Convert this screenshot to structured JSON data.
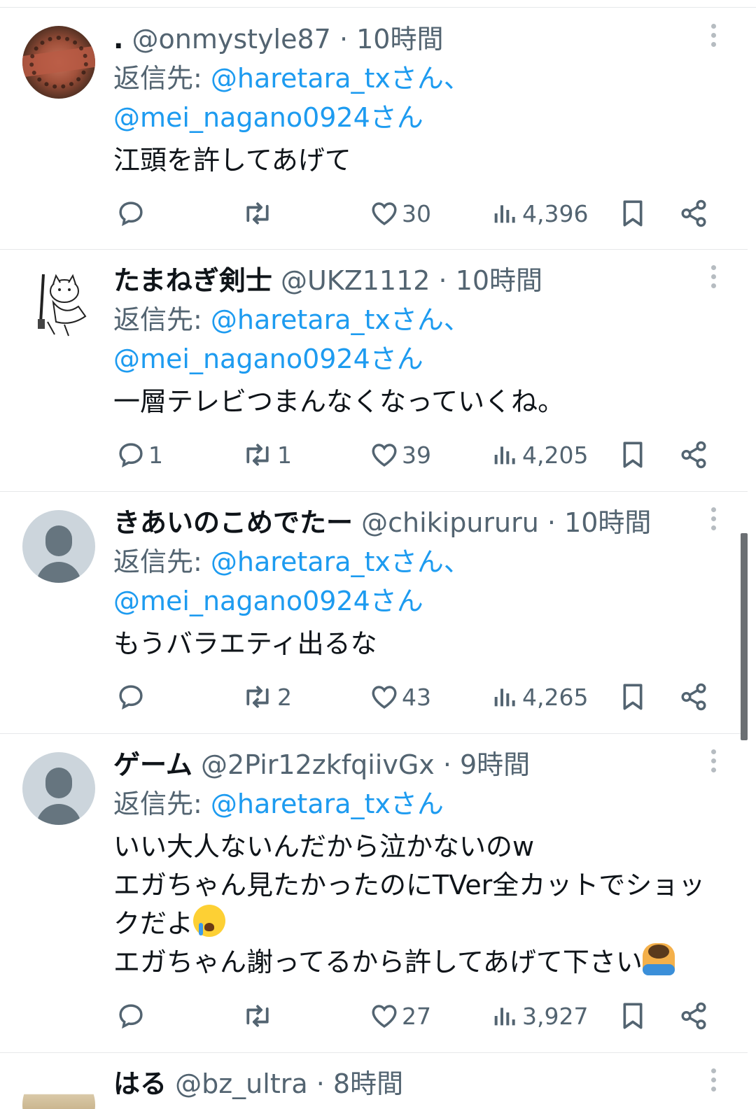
{
  "tweets": [
    {
      "name": ".",
      "handle": "@onmystyle87",
      "time": "10時間",
      "reply_prefix": "返信先: ",
      "mentions": "@haretara_txさん、@mei_nagano0924さん",
      "text": "江頭を許してあげて",
      "replies": "",
      "retweets": "",
      "likes": "30",
      "views": "4,396",
      "avatar": "photo"
    },
    {
      "name": "たまねぎ剣士",
      "handle": "@UKZ1112",
      "time": "10時間",
      "reply_prefix": "返信先: ",
      "mentions": "@haretara_txさん、@mei_nagano0924さん",
      "text": "一層テレビつまんなくなっていくね。",
      "replies": "1",
      "retweets": "1",
      "likes": "39",
      "views": "4,205",
      "avatar": "drawing"
    },
    {
      "name": "きあいのこめでたー",
      "handle": "@chikipururu",
      "time": "10時間",
      "reply_prefix": "返信先: ",
      "mentions": "@haretara_txさん、@mei_nagano0924さん",
      "text": "もうバラエティ出るな",
      "replies": "",
      "retweets": "2",
      "likes": "43",
      "views": "4,265",
      "avatar": "default"
    },
    {
      "name": "ゲーム",
      "handle": "@2Pir12zkfqiivGx",
      "time": "9時間",
      "reply_prefix": "返信先: ",
      "mentions": "@haretara_txさん",
      "text_line1": "いい大人ないんだから泣かないのw",
      "text_line2": "エガちゃん見たかったのにTVer全カットでショックだよ",
      "text_line3": "エガちゃん謝ってるから許してあげて下さい",
      "replies": "",
      "retweets": "",
      "likes": "27",
      "views": "3,927",
      "avatar": "default"
    },
    {
      "name": "はる",
      "handle": "@bz_ultra",
      "time": "8時間",
      "avatar": "photo"
    }
  ],
  "separator": " · ",
  "icons": {
    "reply": "reply-icon",
    "retweet": "retweet-icon",
    "like": "heart-icon",
    "views": "views-icon",
    "bookmark": "bookmark-icon",
    "share": "share-icon",
    "more": "more-icon"
  },
  "colors": {
    "link": "#1d9bf0",
    "secondary": "#536471",
    "text": "#0f1419"
  }
}
